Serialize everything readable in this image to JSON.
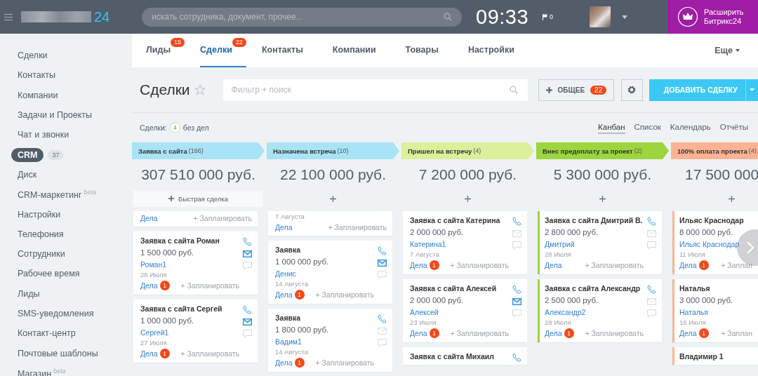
{
  "topbar": {
    "logo_suffix": "24",
    "search_placeholder": "искать сотрудника, документ, прочее...",
    "clock": "09:33",
    "flag_count": "0",
    "upgrade": "Расширить Битрикс24"
  },
  "sidebar": {
    "items": [
      {
        "label": "Сделки",
        "selected": false
      },
      {
        "label": "Контакты",
        "selected": false
      },
      {
        "label": "Компании",
        "selected": false
      },
      {
        "label": "Задачи и Проекты",
        "selected": false
      },
      {
        "label": "Чат и звонки",
        "selected": false
      },
      {
        "label": "CRM",
        "selected": true,
        "count": "37"
      },
      {
        "label": "Диск",
        "selected": false
      },
      {
        "label": "CRM-маркетинг",
        "selected": false,
        "sup": "beta"
      },
      {
        "label": "Настройки",
        "selected": false
      },
      {
        "label": "Телефония",
        "selected": false
      },
      {
        "label": "Сотрудники",
        "selected": false
      },
      {
        "label": "Рабочее время",
        "selected": false
      },
      {
        "label": "Лиды",
        "selected": false
      },
      {
        "label": "SMS-уведомления",
        "selected": false
      },
      {
        "label": "Контакт-центр",
        "selected": false
      },
      {
        "label": "Почтовые шаблоны",
        "selected": false
      },
      {
        "label": "Магазин",
        "selected": false,
        "sup": "beta"
      }
    ]
  },
  "tabs": [
    {
      "label": "Лиды",
      "selected": false,
      "badge": "15"
    },
    {
      "label": "Сделки",
      "selected": true,
      "badge": "22"
    },
    {
      "label": "Контакты",
      "selected": false
    },
    {
      "label": "Компании",
      "selected": false
    },
    {
      "label": "Товары",
      "selected": false
    },
    {
      "label": "Настройки",
      "selected": false
    }
  ],
  "more_tab": "Еще",
  "toolbar": {
    "title": "Сделки",
    "filter_placeholder": "Фильтр + поиск",
    "general_button": "ОБЩЕЕ",
    "general_count": "22",
    "add_button": "ДОБАВИТЬ СДЕЛКУ"
  },
  "summary": {
    "label": "Сделки:",
    "count": "4",
    "suffix": "без дел"
  },
  "views": [
    {
      "label": "Канбан",
      "selected": true
    },
    {
      "label": "Список",
      "selected": false
    },
    {
      "label": "Календарь",
      "selected": false
    },
    {
      "label": "Отчёты",
      "selected": false
    }
  ],
  "columns": [
    {
      "name": "Заявка с сайта",
      "count": "(166)",
      "color": "#a8e3f6",
      "total": "307 510 000 руб.",
      "quick_add": "Быстрая сделка",
      "accent_cards": false,
      "cards": [
        {
          "kind": "partial",
          "tasks": "Дела",
          "plan": "+ Запланировать"
        },
        {
          "kind": "full",
          "title": "Заявка с сайта Роман",
          "price": "1 500 000 руб.",
          "contact": "Роман1",
          "date": "28 Июля",
          "tasks": "Дела",
          "tasks_count": "1",
          "plan": "+ Запланировать",
          "icons": {
            "mail_active": true
          }
        },
        {
          "kind": "full",
          "title": "Заявка с сайта Сергей",
          "price": "1 000 000 руб.",
          "contact": "Сергей1",
          "date": "27 Июля",
          "tasks": "Дела",
          "tasks_count": "1",
          "plan": "+ Запланировать",
          "icons": {
            "mail_active": true
          }
        }
      ]
    },
    {
      "name": "Назначена встреча",
      "count": "(10)",
      "color": "#a8e3f6",
      "total": "22 100 000 руб.",
      "accent_cards": false,
      "cards": [
        {
          "kind": "partial",
          "date": "7 Августа",
          "tasks": "Дела",
          "plan": "+ Запланировать"
        },
        {
          "kind": "full",
          "title": "Заявка",
          "price": "1 000 000 руб.",
          "contact": "Денис",
          "date": "14 Августа",
          "tasks": "Дела",
          "tasks_count": "1",
          "plan": "+ Запланировать",
          "icons": {
            "mail_active": true
          }
        },
        {
          "kind": "full",
          "title": "Заявка",
          "price": "1 800 000 руб.",
          "contact": "Вадим1",
          "date": "14 Августа",
          "tasks": "Дела",
          "tasks_count": "1",
          "plan": "+ Запланировать",
          "icons": {
            "mail_active": false
          }
        }
      ]
    },
    {
      "name": "Пришел на встречу",
      "count": "(4)",
      "color": "#dcef9b",
      "total": "7 200 000 руб.",
      "accent_cards": false,
      "cards": [
        {
          "kind": "full",
          "title": "Заявка с сайта Катерина",
          "price": "2 000 000 руб.",
          "contact": "Катерина1",
          "date": "7 Августа",
          "tasks": "Дела",
          "tasks_count": "1",
          "plan": "+ Запланировать",
          "icons": {
            "mail_active": false
          }
        },
        {
          "kind": "full",
          "title": "Заявка с сайта Алексей",
          "price": "2 000 000 руб.",
          "contact": "Алексей",
          "date": "23 Июля",
          "tasks": "Дела",
          "tasks_count": "1",
          "plan": "+ Запланировать",
          "icons": {
            "mail_active": true
          }
        },
        {
          "kind": "title_only",
          "title": "Заявка с сайта Михаил",
          "icons": {
            "phone": true
          }
        }
      ]
    },
    {
      "name": "Внес предоплату за проект",
      "count": "(2)",
      "color": "#9dd53e",
      "total": "5 300 000 руб.",
      "accent_cards": true,
      "cards": [
        {
          "kind": "full",
          "title": "Заявка с сайта Дмитрий В.",
          "price": "2 800 000 руб.",
          "contact": "Дмитрий",
          "date": "28 Июля",
          "tasks": "Дела",
          "plan": "+ Запланировать",
          "icons": {
            "mail_active": false
          }
        },
        {
          "kind": "full",
          "title": "Заявка с сайта Александр",
          "price": "2 500 000 руб.",
          "contact": "Александр2",
          "date": "28 Июля",
          "tasks": "Дела",
          "tasks_count": "1",
          "plan": "+ Запланировать",
          "icons": {
            "mail_active": false
          }
        }
      ]
    },
    {
      "name": "100% оплата проекта",
      "count": "(4)",
      "color": "#fbb393",
      "total": "17 500 000",
      "accent_cards": true,
      "cards": [
        {
          "kind": "full",
          "title": "Ильяс Краснодар",
          "price": "8 000 000 руб.",
          "contact": "Ильяс Краснодар",
          "date": "11 Июля",
          "tasks": "Дела",
          "tasks_count": "1",
          "plan": "+ Заплан"
        },
        {
          "kind": "full",
          "title": "Наталья",
          "price": "3 000 000 руб.",
          "contact": "Наталья",
          "date": "16 Июля",
          "tasks": "Дела",
          "tasks_count": "1",
          "plan": "+ Заплан"
        },
        {
          "kind": "title_only",
          "title": "Владимир 1"
        }
      ]
    }
  ]
}
